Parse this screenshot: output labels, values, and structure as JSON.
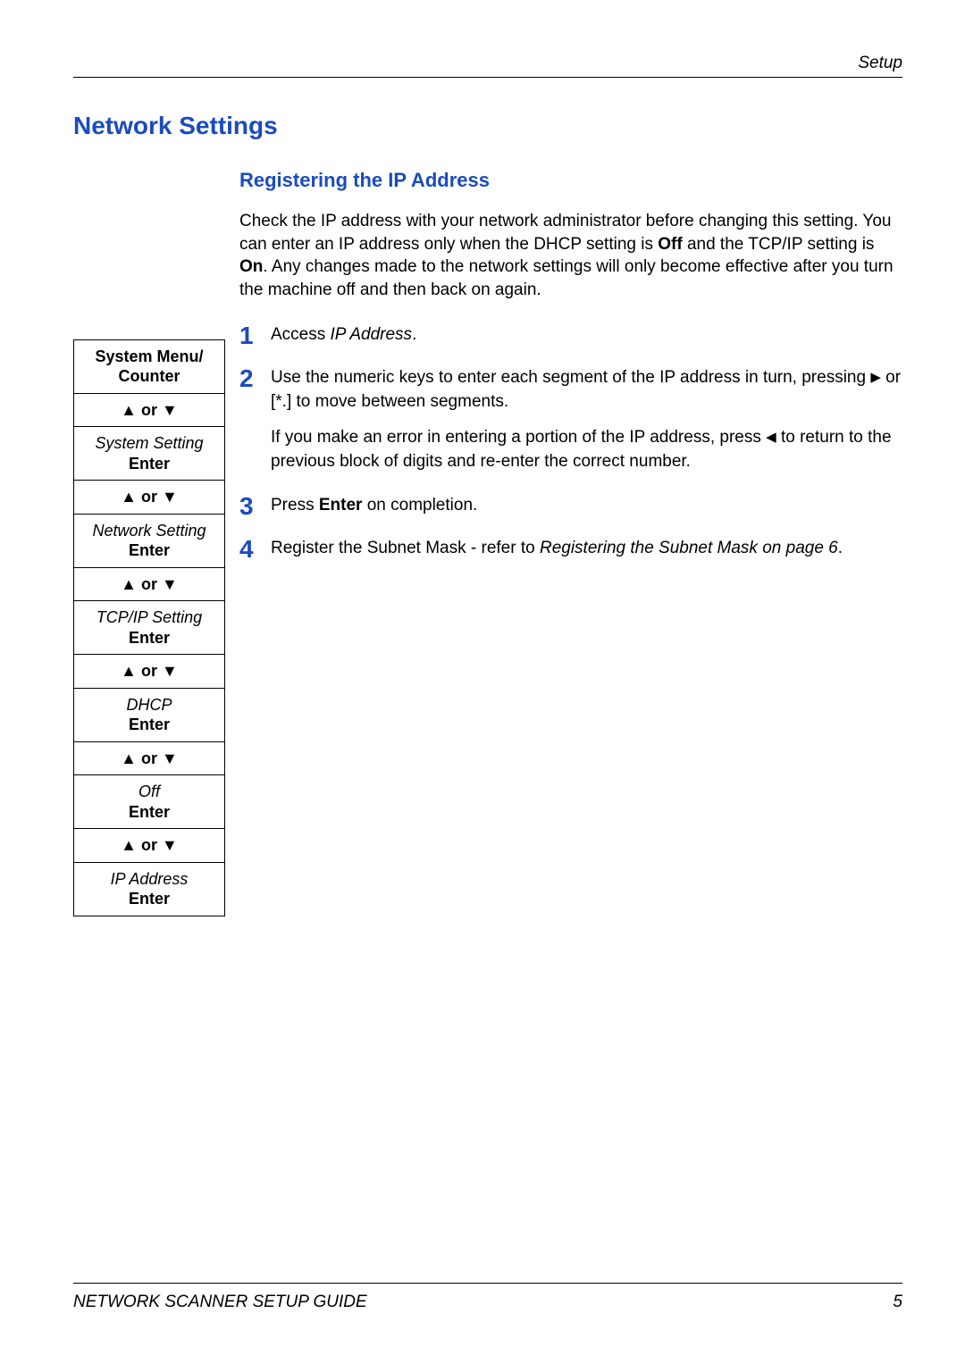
{
  "header": {
    "section": "Setup"
  },
  "title": "Network Settings",
  "subtitle": "Registering the IP Address",
  "intro": {
    "p1a": "Check the IP address with your network administrator before changing this setting. You can enter an IP address only when the DHCP setting is ",
    "p1b": "Off",
    "p1c": " and the TCP/IP setting is ",
    "p1d": "On",
    "p1e": ". Any changes made to the network settings will only become effective after you turn the machine off and then back on again."
  },
  "nav": {
    "up_or_down": "▲ or ▼",
    "enter": "Enter",
    "root1": "System Menu/",
    "root2": "Counter",
    "sys": "System Setting",
    "net": "Network Setting",
    "tcp": "TCP/IP Setting",
    "dhcp": "DHCP",
    "off": "Off",
    "ip": "IP Address"
  },
  "steps": {
    "s1": {
      "n": "1",
      "a": "Access ",
      "b": "IP Address",
      "c": "."
    },
    "s2": {
      "n": "2",
      "a": "Use the numeric keys to enter each segment of the IP address in turn, pressing ",
      "tri_r": "▶",
      "b": " or [*.] to move between segments.",
      "sub_a": "If you make an error in entering a portion of the IP address, press ",
      "tri_l": "◀",
      "sub_b": " to return to the previous block of digits and re-enter the correct number."
    },
    "s3": {
      "n": "3",
      "a": "Press ",
      "b": "Enter",
      "c": " on completion."
    },
    "s4": {
      "n": "4",
      "a": "Register the Subnet Mask - refer to ",
      "b": "Registering the Subnet Mask on page 6",
      "c": "."
    }
  },
  "footer": {
    "title": "NETWORK SCANNER SETUP GUIDE",
    "page": "5"
  }
}
